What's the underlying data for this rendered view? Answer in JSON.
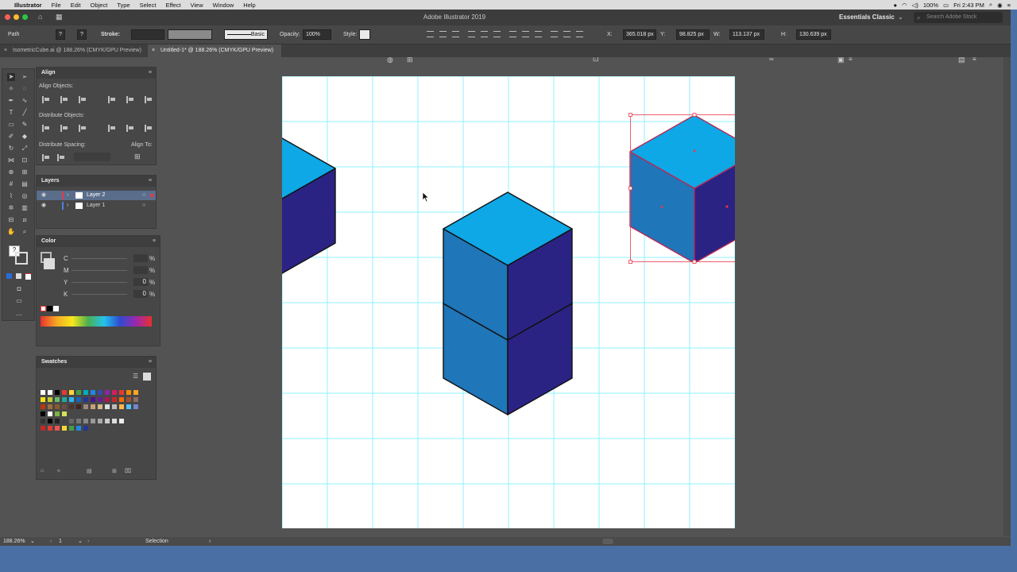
{
  "menubar": {
    "items": [
      "Illustrator",
      "File",
      "Edit",
      "Object",
      "Type",
      "Select",
      "Effect",
      "View",
      "Window",
      "Help"
    ],
    "battery": "100%",
    "clock": "Fri 2:43 PM"
  },
  "window": {
    "title": "Adobe Illustrator 2019",
    "workspace": "Essentials Classic",
    "search_placeholder": "Search Adobe Stock"
  },
  "control": {
    "selection_type": "Path",
    "stroke_label": "Stroke:",
    "brush": "Basic",
    "opacity_label": "Opacity:",
    "opacity": "100%",
    "style_label": "Style:",
    "x_label": "X:",
    "x": "365.018 px",
    "y_label": "Y:",
    "y": "98.825 px",
    "w_label": "W:",
    "w": "113.137 px",
    "h_label": "H:",
    "h": "130.639 px"
  },
  "tabs": [
    {
      "label": "IsometricCube.ai @ 188.26% (CMYK/GPU Preview)",
      "active": false
    },
    {
      "label": "Untitled-1* @ 188.26% (CMYK/GPU Preview)",
      "active": true
    }
  ],
  "align_panel": {
    "title": "Align",
    "align_objects": "Align Objects:",
    "distribute_objects": "Distribute Objects:",
    "distribute_spacing": "Distribute Spacing:",
    "align_to": "Align To:"
  },
  "layers_panel": {
    "title": "Layers",
    "layers": [
      {
        "name": "Layer 2",
        "selected": true,
        "color": "#e8394a"
      },
      {
        "name": "Layer 1",
        "selected": false,
        "color": "#4f7fe0"
      }
    ]
  },
  "color_panel": {
    "title": "Color",
    "channels": [
      {
        "label": "C",
        "value": "",
        "unit": "%"
      },
      {
        "label": "M",
        "value": "",
        "unit": "%"
      },
      {
        "label": "Y",
        "value": "0",
        "unit": "%"
      },
      {
        "label": "K",
        "value": "0",
        "unit": "%"
      }
    ]
  },
  "swatches_panel": {
    "title": "Swatches"
  },
  "cube_colors": {
    "top": "#0ea8e6",
    "left": "#1f76b9",
    "right": "#2b2384",
    "selection": "#e8394a",
    "grid": "#8ff0ff"
  },
  "status": {
    "zoom": "188.26%",
    "artboard": "1",
    "mode": "Selection"
  }
}
